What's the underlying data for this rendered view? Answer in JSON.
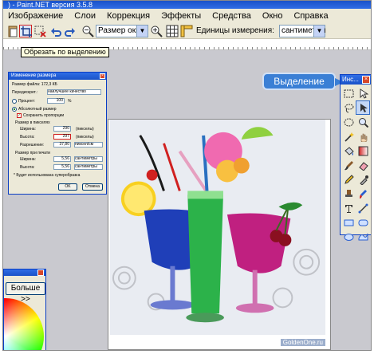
{
  "window": {
    "title": ") - Paint.NET версия 3.5.8"
  },
  "menu": [
    "Изображение",
    "Слои",
    "Коррекция",
    "Эффекты",
    "Средства",
    "Окно",
    "Справка"
  ],
  "toolbar": {
    "zoom_select": "Размер окн",
    "units_label": "Единицы измерения:",
    "units_select": "сантиметры",
    "tooltip": "Обрезать по выделению"
  },
  "dialog": {
    "title": "Изменение размера",
    "file_size": "Размер файла: 172,3 КБ",
    "resampling_label": "Передискрет.:",
    "resampling_value": "наилучшее качество",
    "percent_label": "Процент:",
    "percent_value": "100",
    "percent_unit": "%",
    "absolute_label": "Абсолютный размер",
    "keep_ratio_label": "Сохранить пропорции",
    "pixel_size_label": "Размер в пикселях",
    "width_label": "Ширина:",
    "width_value": "290",
    "width_unit": "(пикселы)",
    "height_label": "Высота:",
    "height_value": "297",
    "height_unit": "(пикселы)",
    "resolution_label": "Разрешение:",
    "resolution_value": "37,80",
    "resolution_unit": "пиксел/см",
    "print_size_label": "Размер при печати",
    "print_width_label": "Ширина:",
    "print_width_value": "5,56",
    "print_width_unit": "сантиметры",
    "print_height_label": "Высота:",
    "print_height_value": "5,56",
    "print_height_unit": "сантиметры",
    "note": "* Будет использована суперобразка",
    "ok_label": "OK",
    "cancel_label": "Отмена"
  },
  "callout": {
    "text": "Выделение"
  },
  "tools": {
    "title": "Инс...",
    "items": [
      "rect-select-icon",
      "move-selection-icon",
      "lasso-icon",
      "move-icon",
      "ellipse-select-icon",
      "zoom-icon",
      "magic-wand-icon",
      "hand-icon",
      "paint-bucket-icon",
      "gradient-icon",
      "brush-icon",
      "eraser-icon",
      "pencil-icon",
      "color-picker-icon",
      "clone-stamp-icon",
      "recolor-icon",
      "text-icon",
      "line-icon",
      "rectangle-icon",
      "rounded-rect-icon",
      "ellipse-icon",
      "freeform-icon"
    ]
  },
  "colors": {
    "more_label": "Больше >>"
  },
  "canvas": {
    "watermark": "GoldenOne.ru"
  },
  "accent_color": "#1a52c8",
  "highlight_color": "#d02020"
}
